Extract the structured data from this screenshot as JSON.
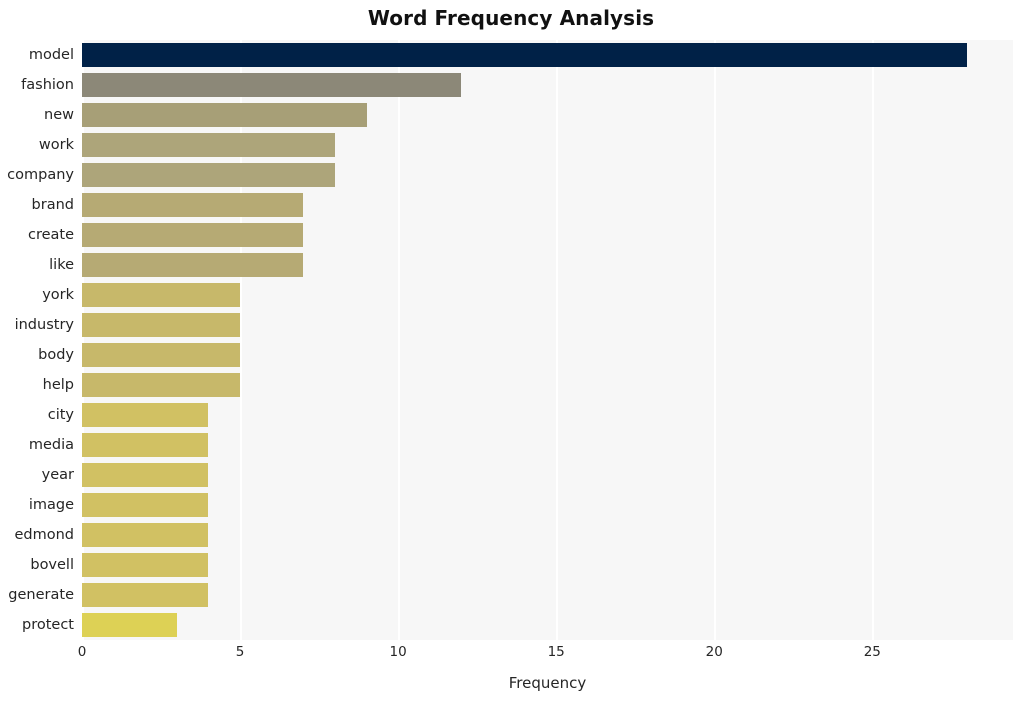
{
  "chart_data": {
    "type": "bar",
    "orientation": "horizontal",
    "title": "Word Frequency Analysis",
    "xlabel": "Frequency",
    "ylabel": "",
    "categories": [
      "model",
      "fashion",
      "new",
      "work",
      "company",
      "brand",
      "create",
      "like",
      "york",
      "industry",
      "body",
      "help",
      "city",
      "media",
      "year",
      "image",
      "edmond",
      "bovell",
      "generate",
      "protect"
    ],
    "values": [
      28,
      12,
      9,
      8,
      8,
      7,
      7,
      7,
      5,
      5,
      5,
      5,
      4,
      4,
      4,
      4,
      4,
      4,
      4,
      3
    ],
    "bar_colors": [
      "#002147",
      "#8c8878",
      "#a79f77",
      "#ada57a",
      "#ada57a",
      "#b6aa74",
      "#b6aa74",
      "#b6aa74",
      "#c7b86a",
      "#c7b86a",
      "#c7b86a",
      "#c7b86a",
      "#d1c163",
      "#d1c163",
      "#d1c163",
      "#d1c163",
      "#d1c163",
      "#d1c163",
      "#d1c163",
      "#ddd155"
    ],
    "xlim": [
      0,
      29.45
    ],
    "xticks": [
      0,
      5,
      10,
      15,
      20,
      25
    ],
    "xtick_labels": [
      "0",
      "5",
      "10",
      "15",
      "20",
      "25"
    ],
    "grid": true,
    "grid_axis": "x",
    "grid_color": "#ffffff",
    "plot_background": "#f7f7f7",
    "figure_background": "#ffffff",
    "legend": null
  }
}
